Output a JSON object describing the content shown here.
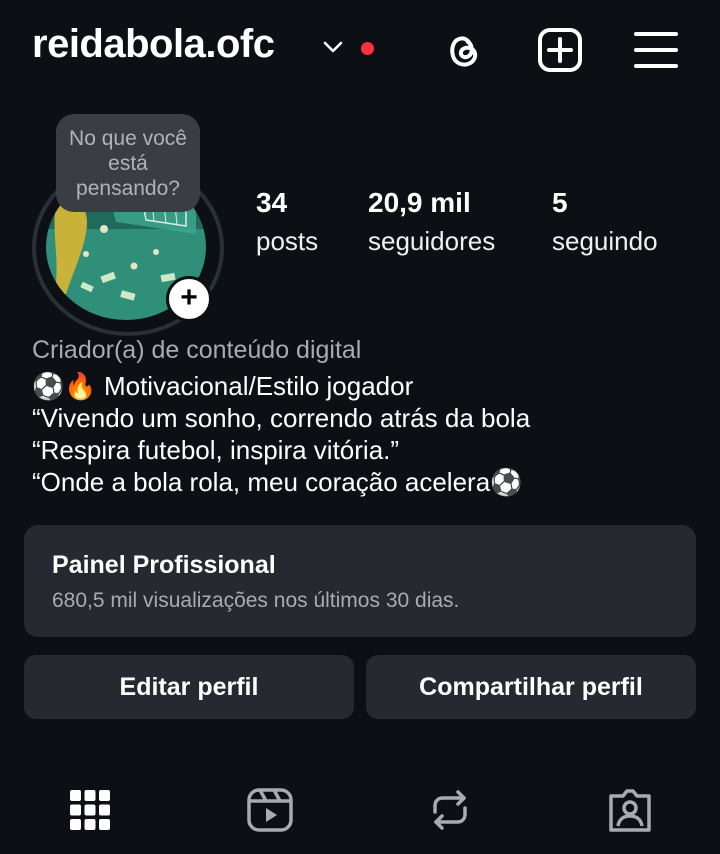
{
  "header": {
    "username": "reidabola.ofc",
    "icons": [
      "chevron-down-icon",
      "notification-dot",
      "threads-icon",
      "create-plus-icon",
      "menu-icon"
    ],
    "notification_dot_color": "#ff3040"
  },
  "profile": {
    "note_placeholder": "No que você está pensando?",
    "stats": {
      "posts": {
        "value": "34",
        "label": "posts"
      },
      "followers": {
        "value": "20,9 mil",
        "label": "seguidores"
      },
      "following": {
        "value": "5",
        "label": "seguindo"
      }
    },
    "category": "Criador(a) de conteúdo digital",
    "bio_lines": [
      "⚽🔥 Motivacional/Estilo jogador",
      "“Vivendo um sonho, correndo atrás da bola",
      "“Respira futebol, inspira vitória.”",
      "“Onde a bola rola, meu coração acelera⚽"
    ]
  },
  "dashboard": {
    "title": "Painel Profissional",
    "subtitle": "680,5 mil visualizações nos últimos 30 dias."
  },
  "actions": {
    "edit_label": "Editar perfil",
    "share_label": "Compartilhar perfil"
  },
  "tabs": [
    {
      "icon": "grid-icon",
      "active": true
    },
    {
      "icon": "reels-icon",
      "active": false
    },
    {
      "icon": "reposts-icon",
      "active": false
    },
    {
      "icon": "tagged-icon",
      "active": false
    }
  ]
}
